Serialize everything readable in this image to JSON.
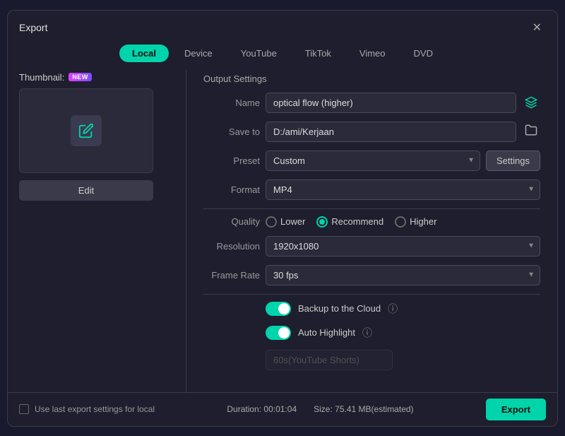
{
  "dialog": {
    "title": "Export",
    "close_label": "✕"
  },
  "tabs": [
    {
      "id": "local",
      "label": "Local",
      "active": true
    },
    {
      "id": "device",
      "label": "Device",
      "active": false
    },
    {
      "id": "youtube",
      "label": "YouTube",
      "active": false
    },
    {
      "id": "tiktok",
      "label": "TikTok",
      "active": false
    },
    {
      "id": "vimeo",
      "label": "Vimeo",
      "active": false
    },
    {
      "id": "dvd",
      "label": "DVD",
      "active": false
    }
  ],
  "left_panel": {
    "thumbnail_label": "Thumbnail:",
    "new_badge": "NEW",
    "edit_button": "Edit"
  },
  "output_settings": {
    "section_title": "Output Settings",
    "name_label": "Name",
    "name_value": "optical flow (higher)",
    "save_to_label": "Save to",
    "save_to_value": "D:/ami/Kerjaan",
    "preset_label": "Preset",
    "preset_value": "Custom",
    "settings_button": "Settings",
    "format_label": "Format",
    "format_value": "MP4",
    "quality_label": "Quality",
    "quality_options": [
      {
        "id": "lower",
        "label": "Lower",
        "checked": false
      },
      {
        "id": "recommend",
        "label": "Recommend",
        "checked": true
      },
      {
        "id": "higher",
        "label": "Higher",
        "checked": false
      }
    ],
    "resolution_label": "Resolution",
    "resolution_value": "1920x1080",
    "frame_rate_label": "Frame Rate",
    "frame_rate_value": "30 fps",
    "backup_label": "Backup to the Cloud",
    "backup_on": true,
    "auto_highlight_label": "Auto Highlight",
    "auto_highlight_on": true,
    "auto_highlight_sub": "60s(YouTube Shorts)"
  },
  "bottom_bar": {
    "checkbox_label": "Use last export settings for local",
    "duration_label": "Duration:",
    "duration_value": "00:01:04",
    "size_label": "Size:",
    "size_value": "75.41 MB(estimated)",
    "export_button": "Export"
  }
}
